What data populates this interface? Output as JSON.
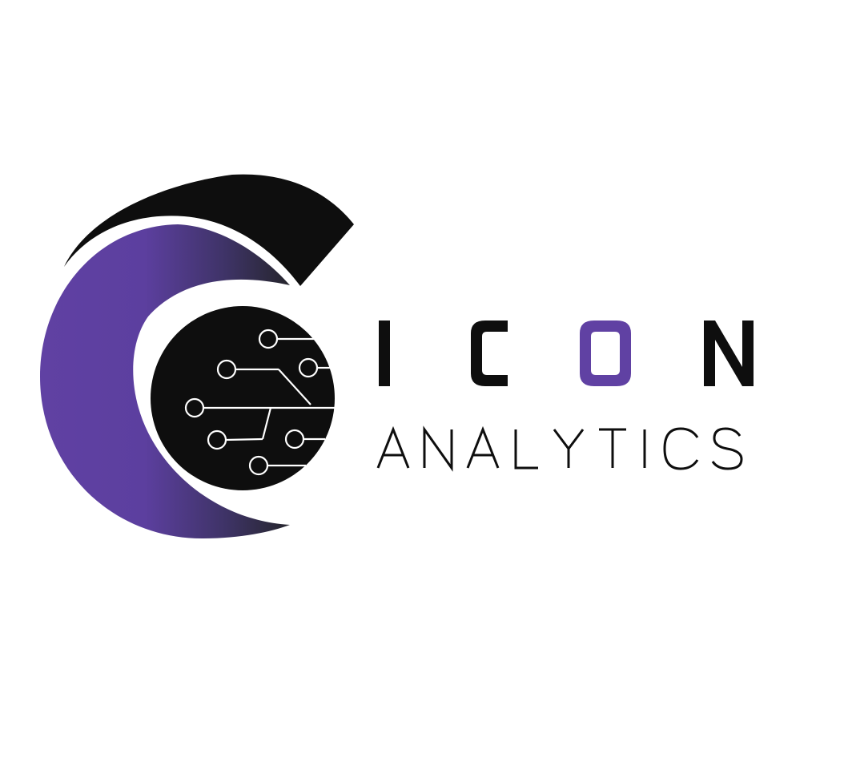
{
  "logo": {
    "name_primary": "ICON",
    "name_secondary": "ANALYTICS",
    "letters_primary": [
      "I",
      "C",
      "O",
      "N"
    ],
    "accent_letter_index": 2
  },
  "colors": {
    "background": "#ffffff",
    "ink": "#0e0e0e",
    "brand_purple": "#6041a3",
    "brand_purple_dark": "#2b2b37",
    "circuit_line": "#ffffff"
  },
  "icons": [
    "crescent-c-icon",
    "circuit-board-icon"
  ]
}
